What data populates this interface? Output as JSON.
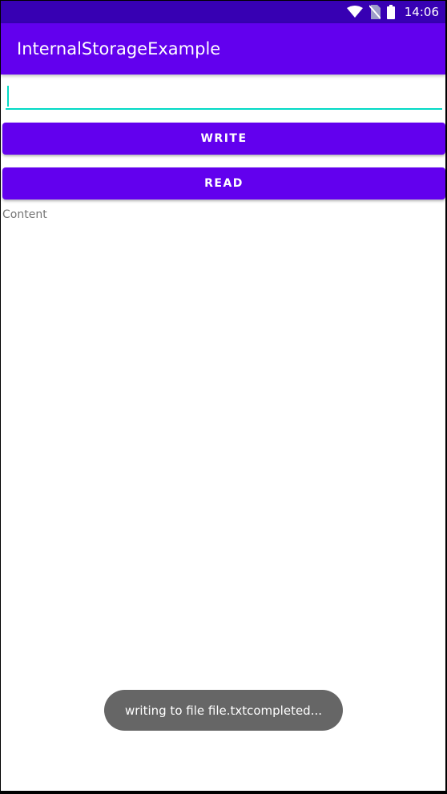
{
  "status_bar": {
    "time": "14:06",
    "icons": [
      "wifi-icon",
      "no-sim-icon",
      "battery-icon"
    ],
    "background": "#3700b3"
  },
  "app_bar": {
    "title": "InternalStorageExample",
    "background": "#6200ee"
  },
  "input": {
    "value": "",
    "accent": "#03dac5"
  },
  "buttons": {
    "write_label": "WRITE",
    "read_label": "READ"
  },
  "content": {
    "label": "Content"
  },
  "toast": {
    "message": "writing to file file.txtcompleted..."
  }
}
